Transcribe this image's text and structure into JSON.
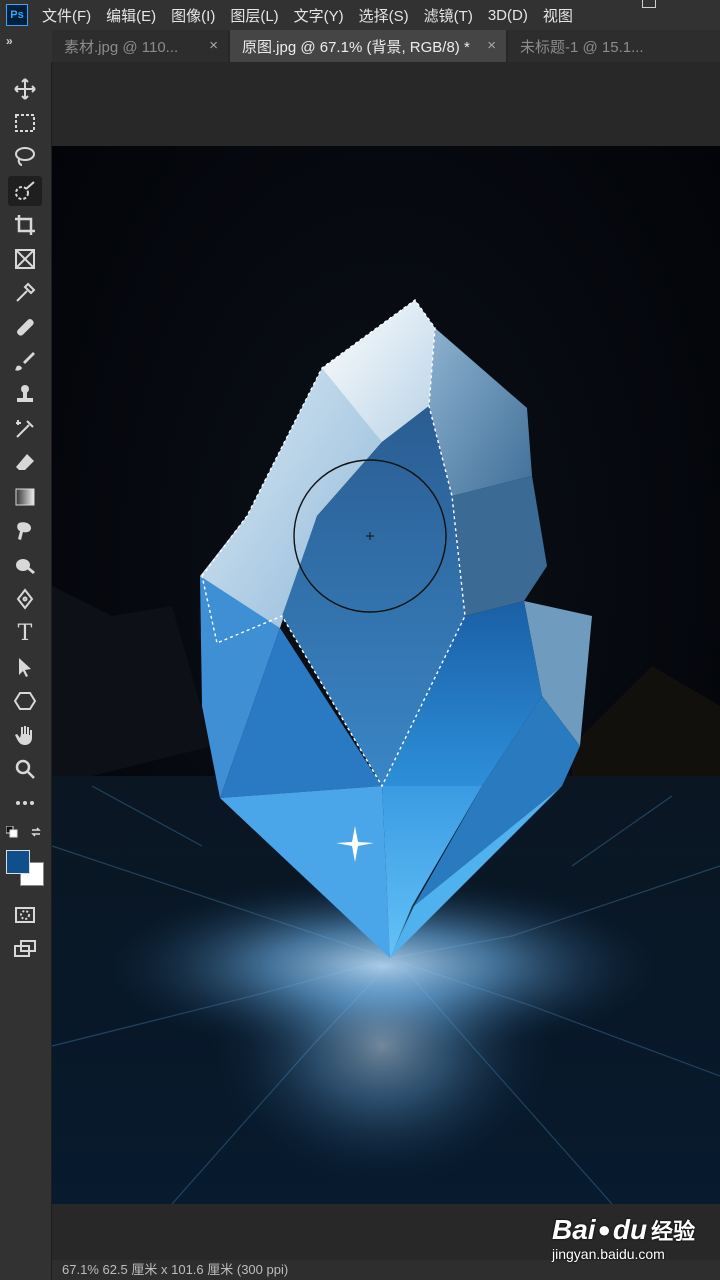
{
  "app": {
    "logo_text": "Ps"
  },
  "menu": [
    "文件(F)",
    "编辑(E)",
    "图像(I)",
    "图层(L)",
    "文字(Y)",
    "选择(S)",
    "滤镜(T)",
    "3D(D)",
    "视图"
  ],
  "panel_toggle": "»",
  "tabs": [
    {
      "label": "素材.jpg @ 110...",
      "active": false
    },
    {
      "label": "原图.jpg @ 67.1% (背景, RGB/8) *",
      "active": true
    },
    {
      "label": "未标题-1 @ 15.1...",
      "active": false
    }
  ],
  "tab_close_glyph": "×",
  "tools": [
    {
      "name": "move-tool"
    },
    {
      "name": "marquee-tool"
    },
    {
      "name": "lasso-tool"
    },
    {
      "name": "quick-selection-tool",
      "active": true
    },
    {
      "name": "crop-tool"
    },
    {
      "name": "frame-tool"
    },
    {
      "name": "eyedropper-tool"
    },
    {
      "name": "healing-brush-tool"
    },
    {
      "name": "brush-tool"
    },
    {
      "name": "clone-stamp-tool"
    },
    {
      "name": "history-brush-tool"
    },
    {
      "name": "eraser-tool"
    },
    {
      "name": "gradient-tool"
    },
    {
      "name": "smudge-tool"
    },
    {
      "name": "dodge-tool"
    },
    {
      "name": "pen-tool"
    },
    {
      "name": "type-tool"
    },
    {
      "name": "path-selection-tool"
    },
    {
      "name": "shape-tool"
    },
    {
      "name": "hand-tool"
    },
    {
      "name": "zoom-tool"
    },
    {
      "name": "more-tools"
    }
  ],
  "type_tool_glyph": "T",
  "colors": {
    "foreground": "#0f4f8c",
    "background": "#ffffff",
    "accent": "#31a8ff"
  },
  "status": {
    "text": "67.1%    62.5 厘米 x 101.6 厘米 (300 ppi)"
  },
  "watermark": {
    "brand": "Bai",
    "brand2": "du",
    "cn": "经验",
    "url": "jingyan.baidu.com"
  }
}
